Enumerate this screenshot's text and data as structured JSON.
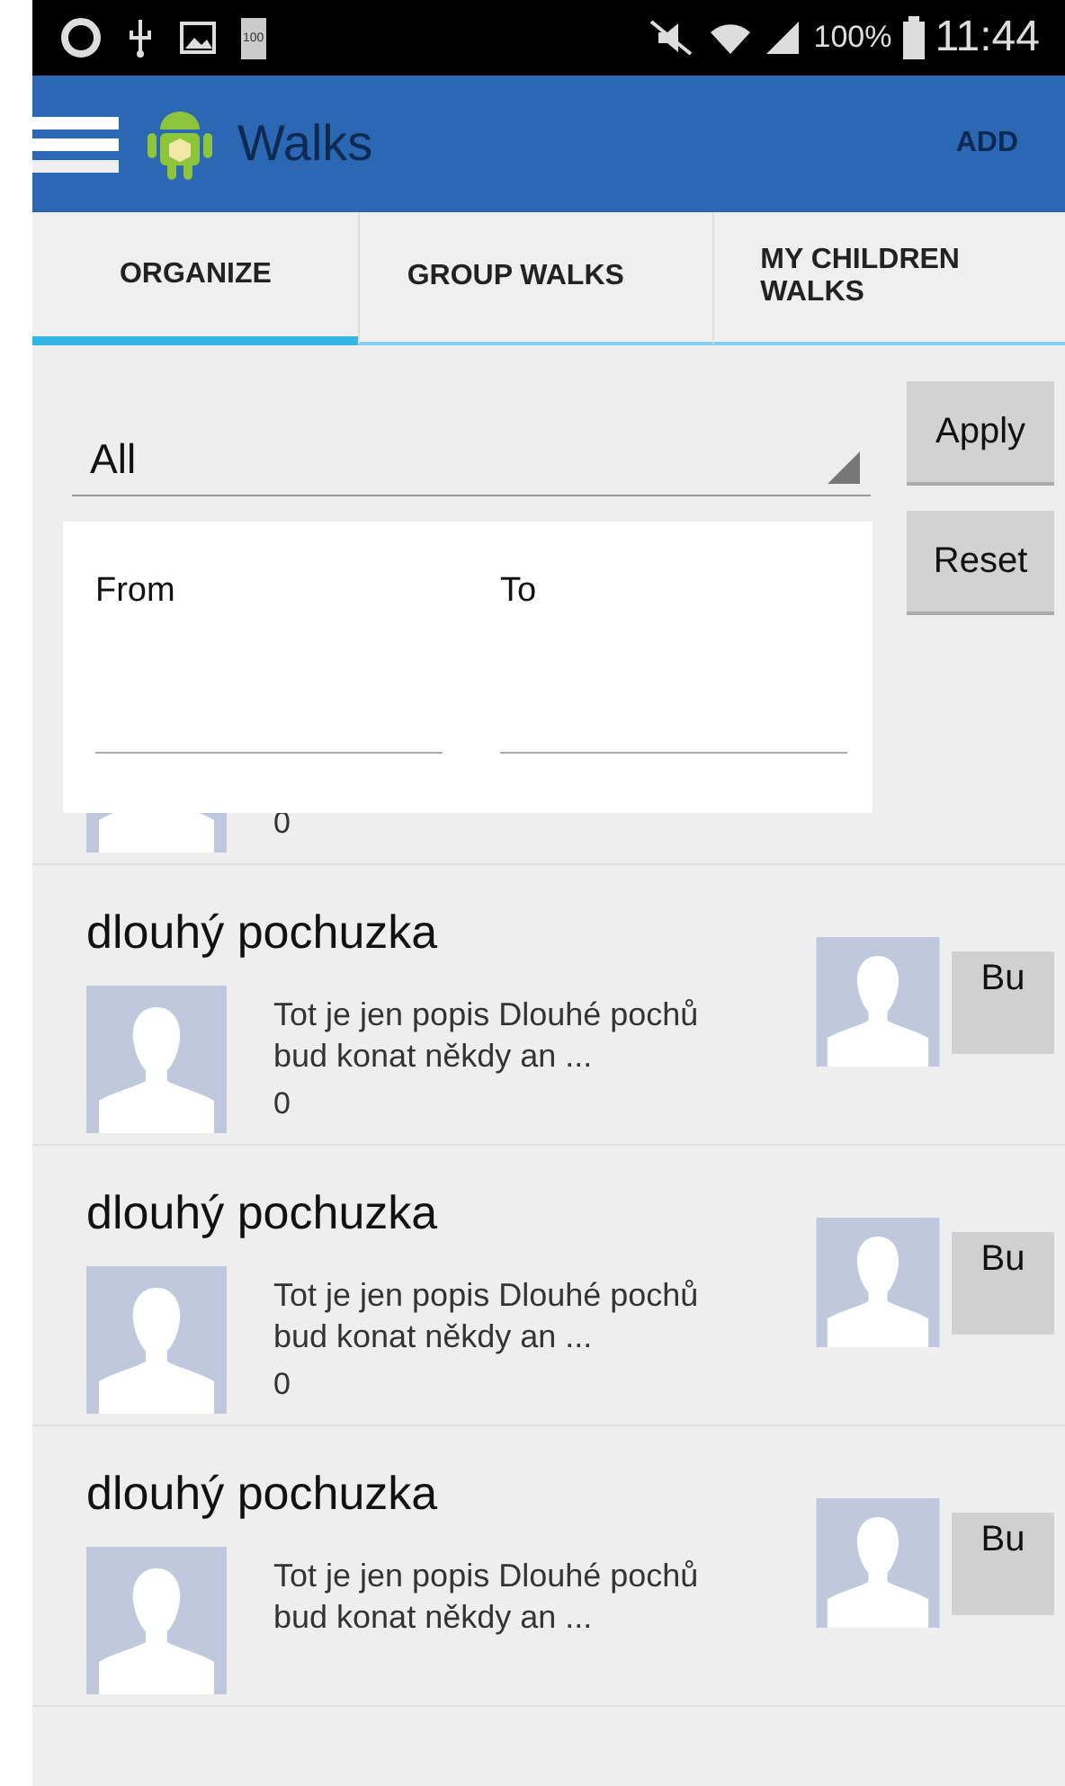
{
  "status_bar": {
    "battery_text": "100",
    "signal_text": "100%",
    "time": "11:44"
  },
  "app_bar": {
    "title": "Walks",
    "action": "ADD"
  },
  "tabs": [
    {
      "label": "ORGANIZE",
      "selected": true
    },
    {
      "label": "GROUP WALKS",
      "selected": false
    },
    {
      "label": "MY CHILDREN WALKS",
      "selected": false
    }
  ],
  "filter": {
    "spinner_value": "All",
    "buttons": [
      "Apply",
      "Reset"
    ]
  },
  "date_panel": {
    "from_label": "From",
    "to_label": "To"
  },
  "walks": [
    {
      "count": "0"
    },
    {
      "title": "dlouhý pochuzka",
      "description": [
        "Tot je jen popis Dlouhé pochů",
        "bud konat někdy an ..."
      ],
      "count": "0",
      "button": "Bu"
    },
    {
      "title": "dlouhý pochuzka",
      "description": [
        "Tot je jen popis Dlouhé pochů",
        "bud konat někdy an ..."
      ],
      "count": "0",
      "button": "Bu"
    },
    {
      "title": "dlouhý pochuzka",
      "description": [
        "Tot je jen popis Dlouhé pochů",
        "bud konat někdy an ..."
      ],
      "button": "Bu"
    }
  ]
}
